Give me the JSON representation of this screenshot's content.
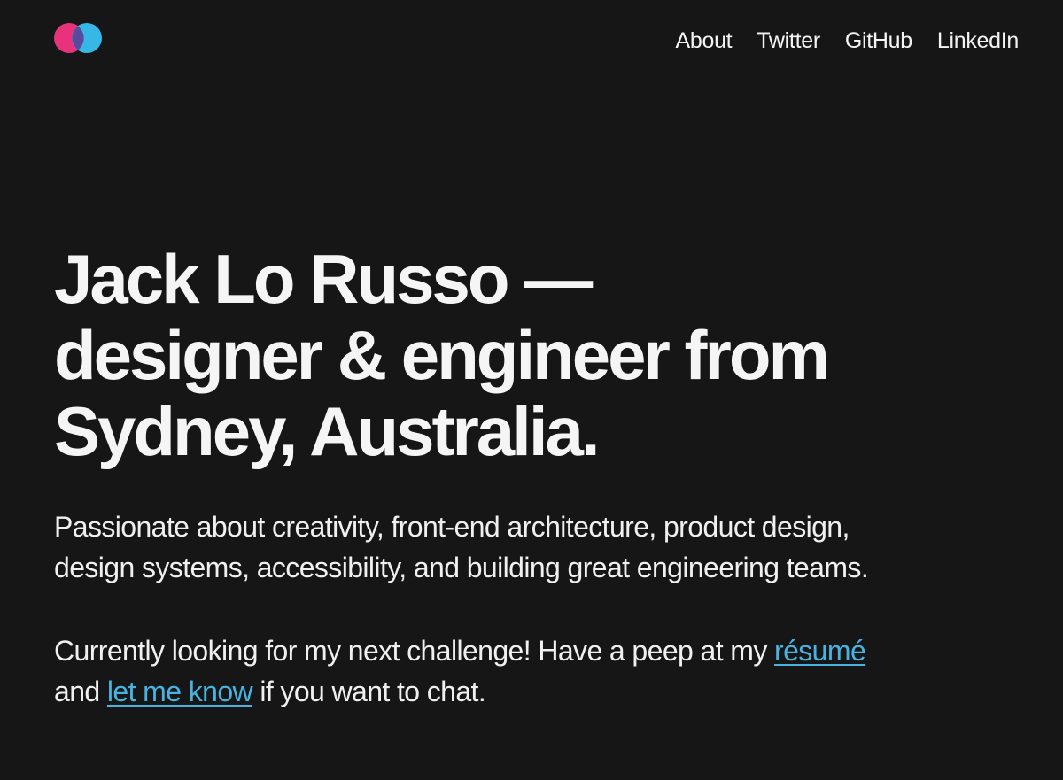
{
  "header": {
    "logo_name": "overlapping-circles-logo",
    "nav": [
      {
        "label": "About"
      },
      {
        "label": "Twitter"
      },
      {
        "label": "GitHub"
      },
      {
        "label": "LinkedIn"
      }
    ]
  },
  "hero": {
    "headline_line1": "Jack Lo Russo —",
    "headline_line2": "designer & engineer from",
    "headline_line3": "Sydney, Australia.",
    "intro_line1": "Passionate about creativity, front-end architecture, product design,",
    "intro_line2": "design systems, accessibility, and building great engineering teams.",
    "cta_part1": "Currently looking for my next challenge! Have a peep at my ",
    "cta_link1": "résumé",
    "cta_part2": "and ",
    "cta_link2": "let me know",
    "cta_part3": " if you want to chat."
  },
  "colors": {
    "background": "#161616",
    "text": "#f4f4f4",
    "link": "#48b3e0",
    "logo_pink": "#e8327c",
    "logo_blue": "#37b7e6"
  }
}
